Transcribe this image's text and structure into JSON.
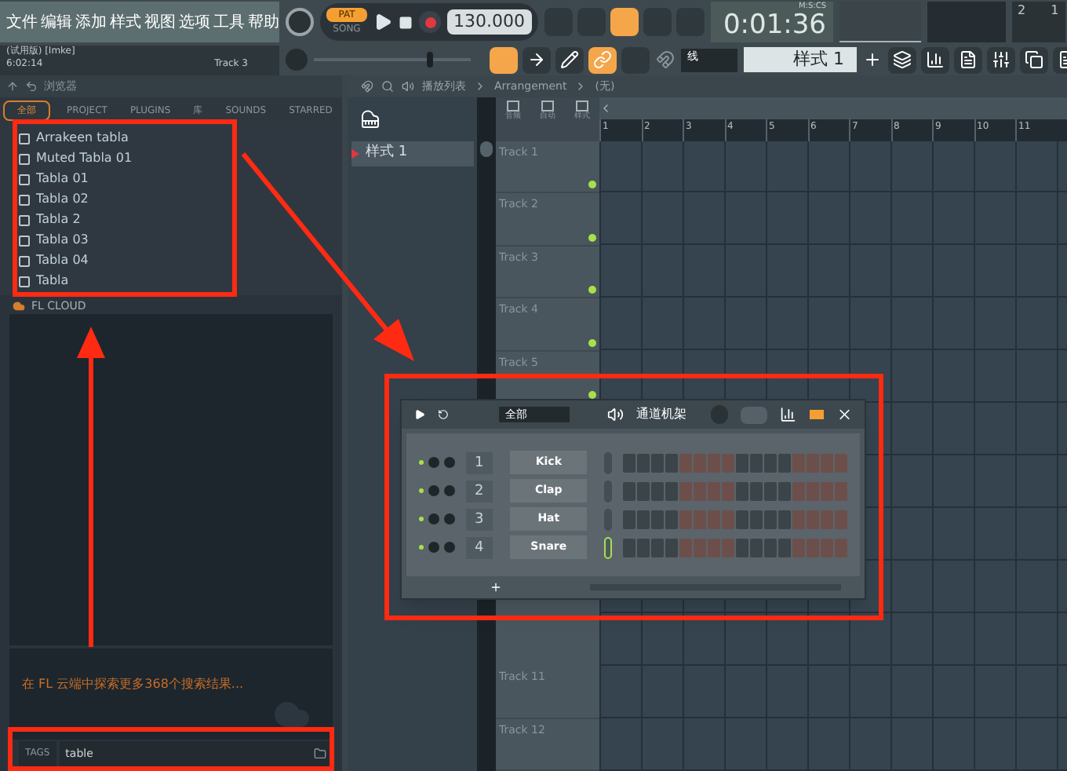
{
  "menu": [
    "文件",
    "编辑",
    "添加",
    "样式",
    "视图",
    "选项",
    "工具",
    "帮助"
  ],
  "transport": {
    "pat_label": "PAT",
    "song_label": "SONG",
    "pat_selected": true,
    "tempo": "130.000",
    "time_unit": "M:S:CS",
    "time": "0:01:36",
    "readouts": [
      "2",
      "1"
    ]
  },
  "master_volume": {
    "level": 0.75
  },
  "hint_panel": {
    "title": "(试用版) [Imke]",
    "time": "6:02:14",
    "track": "Track 3"
  },
  "toolbar": {
    "snap": "线",
    "pattern": "样式 1"
  },
  "browser": {
    "title": "浏览器",
    "tabs": [
      {
        "label": "全部",
        "selected": true
      },
      {
        "label": "PROJECT",
        "selected": false
      },
      {
        "label": "PLUGINS",
        "selected": false
      },
      {
        "label": "库",
        "selected": false
      },
      {
        "label": "SOUNDS",
        "selected": false
      },
      {
        "label": "STARRED",
        "selected": false
      }
    ],
    "results": [
      "Arrakeen tabla",
      "Muted Tabla 01",
      "Tabla 01",
      "Tabla 02",
      "Tabla 2",
      "Tabla 03",
      "Tabla 04",
      "Tabla"
    ],
    "cloud_header": "FL CLOUD",
    "cloud_message": "在 FL 云端中探索更多368个搜索结果...",
    "tags_label": "TAGS",
    "search_value": "table"
  },
  "playlist": {
    "title": "播放列表",
    "breadcrumb": [
      "Arrangement",
      "(无)"
    ],
    "tool_labels": [
      "音频",
      "自动",
      "样式"
    ],
    "patterns": [
      {
        "name": "样式 1",
        "selected": true
      }
    ],
    "ruler": [
      "1",
      "2",
      "3",
      "4",
      "5",
      "6",
      "7",
      "8",
      "9",
      "10",
      "11"
    ],
    "tracks_top": [
      "Track 1",
      "Track 2",
      "Track 3",
      "Track 4",
      "Track 5"
    ],
    "tracks_bottom": [
      "Track 11",
      "Track 12"
    ]
  },
  "channel_rack": {
    "filter": "全部",
    "title": "通道机架",
    "channels": [
      {
        "number": "1",
        "name": "Kick",
        "selected": false
      },
      {
        "number": "2",
        "name": "Clap",
        "selected": false
      },
      {
        "number": "3",
        "name": "Hat",
        "selected": false
      },
      {
        "number": "4",
        "name": "Snare",
        "selected": true
      }
    ]
  }
}
